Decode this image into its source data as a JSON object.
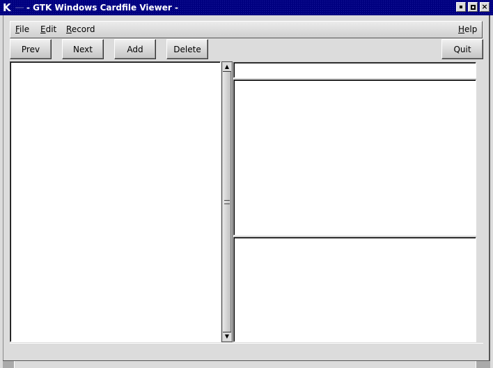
{
  "window": {
    "title": "- GTK Windows Cardfile Viewer -",
    "app_icon": "K",
    "controls": {
      "minimize": "minimize",
      "maximize": "maximize",
      "close": "×"
    }
  },
  "menubar": {
    "items": [
      {
        "label": "File",
        "mnemonic": "F"
      },
      {
        "label": "Edit",
        "mnemonic": "E"
      },
      {
        "label": "Record",
        "mnemonic": "R"
      }
    ],
    "help": {
      "label": "Help",
      "mnemonic": "H"
    }
  },
  "toolbar": {
    "prev_label": "Prev",
    "next_label": "Next",
    "add_label": "Add",
    "delete_label": "Delete",
    "quit_label": "Quit"
  },
  "card_list": {
    "items": []
  },
  "card": {
    "title": "",
    "text": "",
    "picture": ""
  },
  "scrollbar": {
    "up_glyph": "▲",
    "down_glyph": "▼"
  }
}
